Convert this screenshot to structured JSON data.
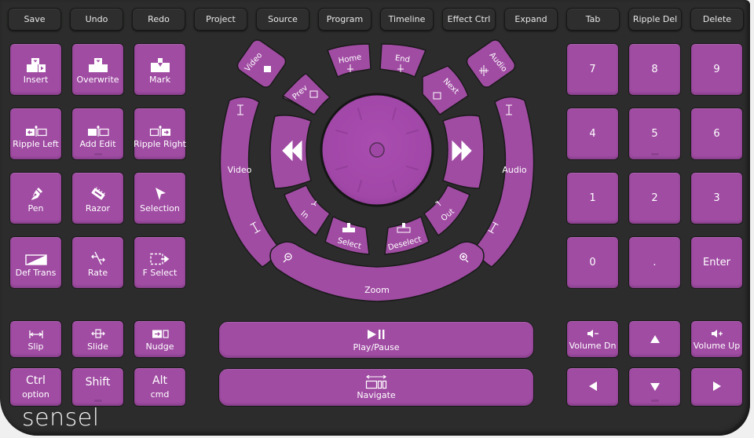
{
  "device": {
    "brand": "sensel",
    "colors": {
      "body": "#2b2c2b",
      "key": "#a04ca3",
      "jog": "#a449ad",
      "top_key": "#2d2e2d",
      "label": "#ffffff"
    }
  },
  "top_row": [
    {
      "label": "Save"
    },
    {
      "label": "Undo"
    },
    {
      "label": "Redo"
    },
    {
      "label": "Project"
    },
    {
      "label": "Source"
    },
    {
      "label": "Program"
    },
    {
      "label": "Timeline"
    },
    {
      "label": "Effect Ctrl"
    },
    {
      "label": "Expand"
    },
    {
      "label": "Tab"
    },
    {
      "label": "Ripple Del"
    },
    {
      "label": "Delete"
    }
  ],
  "left_grid": [
    {
      "label": "Insert",
      "icon": "insert-icon"
    },
    {
      "label": "Overwrite",
      "icon": "overwrite-icon"
    },
    {
      "label": "Mark",
      "icon": "mark-icon"
    },
    {
      "label": "Ripple Left",
      "icon": "ripple-left-icon"
    },
    {
      "label": "Add Edit",
      "icon": "add-edit-icon"
    },
    {
      "label": "Ripple Right",
      "icon": "ripple-right-icon"
    },
    {
      "label": "Pen",
      "icon": "pen-icon"
    },
    {
      "label": "Razor",
      "icon": "razor-icon"
    },
    {
      "label": "Selection",
      "icon": "selection-arrow-icon"
    },
    {
      "label": "Def Trans",
      "icon": "transition-icon"
    },
    {
      "label": "Rate",
      "icon": "rate-stretch-icon"
    },
    {
      "label": "F Select",
      "icon": "forward-select-icon"
    }
  ],
  "left_bottom": [
    {
      "label": "Slip",
      "icon": "slip-icon"
    },
    {
      "label": "Slide",
      "icon": "slide-icon"
    },
    {
      "label": "Nudge",
      "icon": "nudge-icon"
    },
    {
      "label": "Ctrl",
      "sublabel": "option"
    },
    {
      "label": "Shift"
    },
    {
      "label": "Alt",
      "sublabel": "cmd"
    }
  ],
  "wheel": {
    "video_track_small": "Video",
    "prev": "Prev",
    "home": "Home",
    "end": "End",
    "next": "Next",
    "audio_track_small": "Audio",
    "video_arc": "Video",
    "audio_arc": "Audio",
    "rewind_icon": "rewind-icon",
    "fast_forward_icon": "fast-forward-icon",
    "jog": "jog-wheel",
    "in": "In",
    "out": "Out",
    "select": "Select",
    "deselect": "Deselect",
    "zoom": "Zoom"
  },
  "transport": {
    "play_pause": "Play/Pause",
    "navigate": "Navigate"
  },
  "numpad": [
    {
      "label": "7"
    },
    {
      "label": "8"
    },
    {
      "label": "9"
    },
    {
      "label": "4"
    },
    {
      "label": "5"
    },
    {
      "label": "6"
    },
    {
      "label": "1"
    },
    {
      "label": "2"
    },
    {
      "label": "3"
    },
    {
      "label": "0"
    },
    {
      "label": "."
    },
    {
      "label": "Enter"
    }
  ],
  "right_bottom": {
    "volume_down": "Volume Dn",
    "volume_up": "Volume Up",
    "up": "up-arrow",
    "left": "left-arrow",
    "down": "down-arrow",
    "right": "right-arrow"
  }
}
